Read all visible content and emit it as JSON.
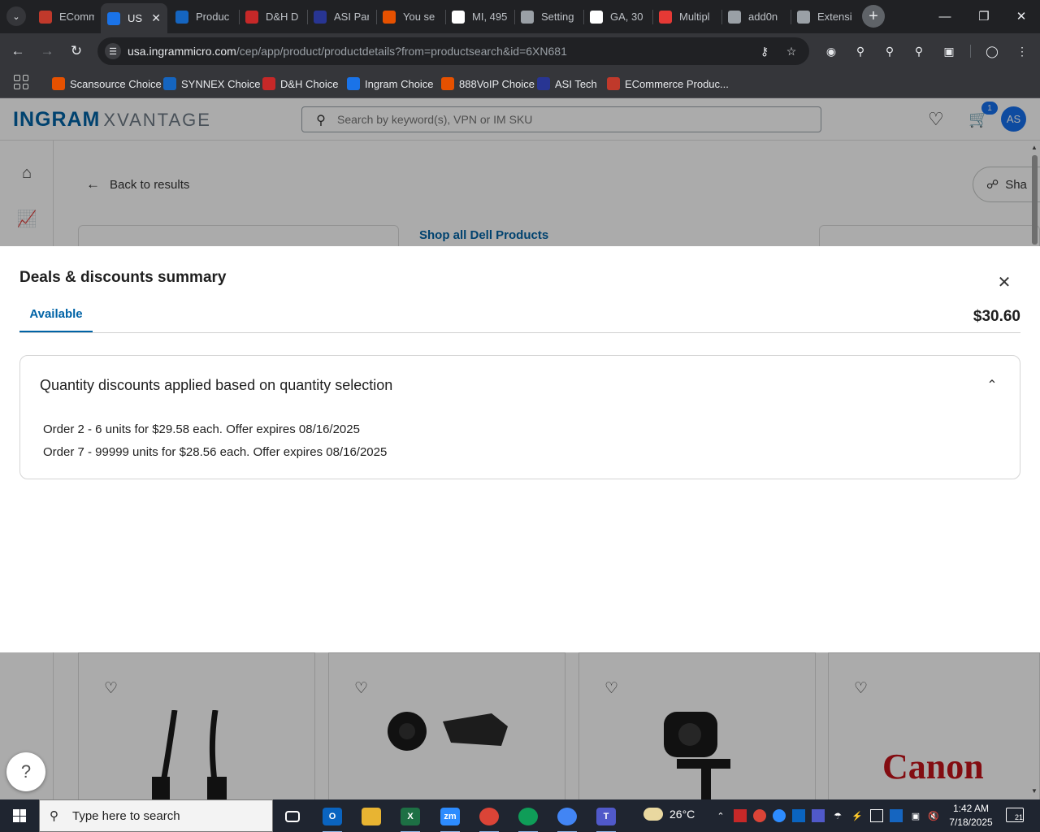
{
  "browser": {
    "tabs": [
      {
        "label": "EComm",
        "icon": "ecommerce-logo-icon",
        "color": "#c0392b"
      },
      {
        "label": "US",
        "icon": "ingram-logo-icon",
        "color": "#1a73e8",
        "active": true
      },
      {
        "label": "Produc",
        "icon": "ec-logo-icon",
        "color": "#1565c0"
      },
      {
        "label": "D&H D",
        "icon": "dh-logo-icon",
        "color": "#c62828"
      },
      {
        "label": "ASI Par",
        "icon": "asi-logo-icon",
        "color": "#283593"
      },
      {
        "label": "You se",
        "icon": "888voip-logo-icon",
        "color": "#e65100"
      },
      {
        "label": "MI, 495",
        "icon": "google-icon",
        "color": "#ffffff"
      },
      {
        "label": "Setting",
        "icon": "gear-icon",
        "color": "#9aa0a6"
      },
      {
        "label": "GA, 30",
        "icon": "google-icon",
        "color": "#ffffff"
      },
      {
        "label": "Multipl",
        "icon": "multiple-icon",
        "color": "#e53935"
      },
      {
        "label": "add0n",
        "icon": "addon-icon",
        "color": "#9aa0a6"
      },
      {
        "label": "Extensi",
        "icon": "puzzle-icon",
        "color": "#9aa0a6"
      }
    ],
    "url_host": "usa.ingrammicro.com",
    "url_path": "/cep/app/product/productdetails?from=productsearch&id=6XN681",
    "bookmarks": [
      {
        "label": "Scansource Choice",
        "icon": "scansource-icon",
        "color": "#e65100"
      },
      {
        "label": "SYNNEX Choice",
        "icon": "ec-logo-icon",
        "color": "#1565c0"
      },
      {
        "label": "D&H Choice",
        "icon": "dh-logo-icon",
        "color": "#c62828"
      },
      {
        "label": "Ingram Choice",
        "icon": "ingram-logo-icon",
        "color": "#1a73e8"
      },
      {
        "label": "888VoIP Choice",
        "icon": "888voip-logo-icon",
        "color": "#e65100"
      },
      {
        "label": "ASI Tech",
        "icon": "asi-logo-icon",
        "color": "#283593"
      },
      {
        "label": "ECommerce Produc...",
        "icon": "ecommerce-logo-icon",
        "color": "#c0392b"
      }
    ]
  },
  "site": {
    "logo_main": "INGRAM",
    "logo_sub": "XVANTAGE",
    "search_placeholder": "Search by keyword(s), VPN or IM SKU",
    "cart_count": "1",
    "avatar_initials": "AS",
    "back_label": "Back to results",
    "share_label": "Sha",
    "shop_all_label": "Shop all Dell Products"
  },
  "modal": {
    "title": "Deals & discounts summary",
    "tab_label": "Available",
    "total_price": "$30.60",
    "section_title": "Quantity discounts applied based on quantity selection",
    "lines": [
      "Order 2 - 6 units for $29.58 each. Offer expires 08/16/2025",
      "Order 7 - 99999 units for $28.56 each. Offer expires 08/16/2025"
    ]
  },
  "taskbar": {
    "search_placeholder": "Type here to search",
    "weather_temp": "26°C",
    "time": "1:42 AM",
    "date": "7/18/2025",
    "notification_count": "21"
  }
}
